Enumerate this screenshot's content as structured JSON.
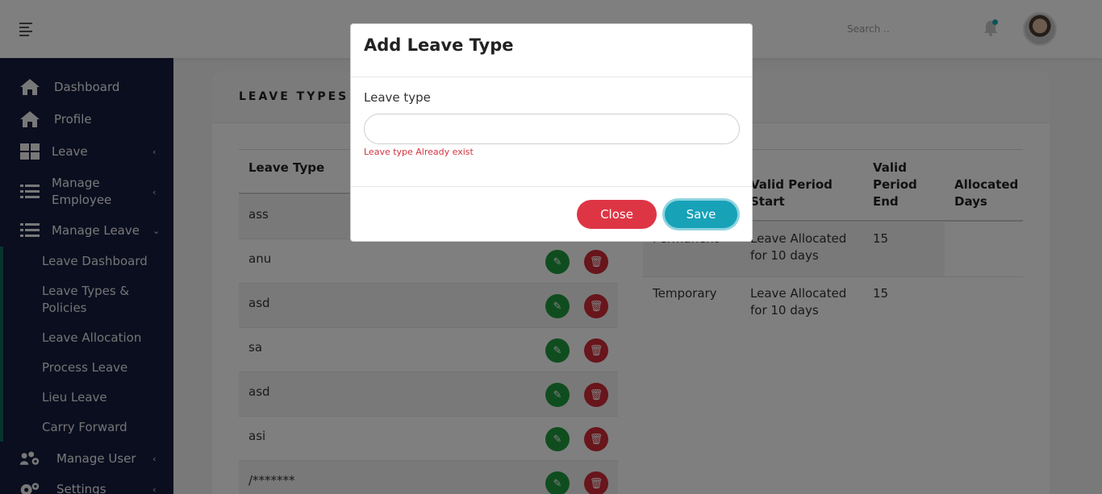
{
  "header": {
    "search_placeholder": "Search ..",
    "icons": [
      "menu-icon",
      "bell-icon"
    ],
    "notification_dot_color": "#1aa6b5"
  },
  "sidebar": {
    "items": [
      {
        "label": "Dashboard",
        "icon": "home-icon"
      },
      {
        "label": "Profile",
        "icon": "home-icon"
      },
      {
        "label": "Leave",
        "icon": "grid-icon",
        "chevron": "‹"
      },
      {
        "label": "Manage Employee",
        "icon": "list-icon",
        "chevron": "‹"
      },
      {
        "label": "Manage Leave",
        "icon": "list-icon",
        "chevron": "⌄"
      },
      {
        "label": "Manage User",
        "icon": "users-cog-icon",
        "chevron": "‹"
      },
      {
        "label": "Settings",
        "icon": "gears-icon",
        "chevron": "‹"
      }
    ],
    "sub_items": [
      "Leave Dashboard",
      "Leave Types & Policies",
      "Leave Allocation",
      "Process Leave",
      "Lieu Leave",
      "Carry Forward"
    ],
    "background": "#141d3f"
  },
  "main": {
    "card_title": "LEAVE TYPES &",
    "left_table": {
      "header": "Leave Type",
      "rows": [
        "ass",
        "anu",
        "asd",
        "sa",
        "asd",
        "asi",
        "/*******"
      ]
    },
    "right_table": {
      "headers": [
        "Valid Period Start",
        "Valid Period End",
        "Allocated Days"
      ],
      "rows": [
        {
          "type": "Permanent",
          "start": "Leave Allocated for 10 days",
          "end": "15"
        },
        {
          "type": "Temporary",
          "start": "Leave Allocated for 10 days",
          "end": "15"
        }
      ]
    }
  },
  "modal": {
    "title": "Add Leave Type",
    "field_label": "Leave type",
    "field_value": "",
    "error": "Leave type Already exist",
    "close_label": "Close",
    "save_label": "Save",
    "close_color": "#de3545",
    "save_color": "#17a2b8"
  }
}
